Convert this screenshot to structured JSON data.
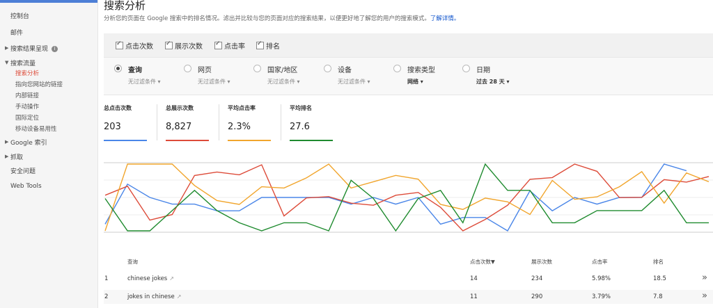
{
  "sidebar": {
    "items": {
      "dashboard": "控制台",
      "mail": "邮件",
      "search_appearance": "搜索结果呈现",
      "search_traffic": "搜索流量",
      "search_analytics": "搜索分析",
      "links": "指向您网站的链接",
      "internal_links": "内部链接",
      "manual_actions": "手动操作",
      "intl_targeting": "国际定位",
      "mobile_usability": "移动设备易用性",
      "google_index": "Google 索引",
      "crawl": "抓取",
      "security": "安全问题",
      "web_tools": "Web Tools"
    }
  },
  "page": {
    "title": "搜索分析",
    "description": "分析您的页面在 Google 搜索中的排名情况。滤出并比较与您的页面对应的搜索结果，以便更好地了解您的用户的搜索模式。",
    "learn_more": "了解详情。"
  },
  "metrics": {
    "clicks": "点击次数",
    "impressions": "展示次数",
    "ctr": "点击率",
    "position": "排名"
  },
  "filters": {
    "query": {
      "label": "查询",
      "sub": "无过滤条件 ▾"
    },
    "page": {
      "label": "网页",
      "sub": "无过滤条件 ▾"
    },
    "country": {
      "label": "国家/地区",
      "sub": "无过滤条件 ▾"
    },
    "device": {
      "label": "设备",
      "sub": "无过滤条件 ▾"
    },
    "search_type": {
      "label": "搜索类型",
      "sub": "网络 ▾"
    },
    "date": {
      "label": "日期",
      "sub": "过去 28 天 ▾"
    }
  },
  "totals": {
    "clicks": {
      "label": "总点击次数",
      "value": "203",
      "color": "#4a86e8"
    },
    "impressions": {
      "label": "总展示次数",
      "value": "8,827",
      "color": "#dd4b39"
    },
    "ctr": {
      "label": "平均点击率",
      "value": "2.3%",
      "color": "#f1a52c"
    },
    "position": {
      "label": "平均排名",
      "value": "27.6",
      "color": "#1f8b2f"
    }
  },
  "chart_data": {
    "type": "line",
    "x": [
      1,
      2,
      3,
      4,
      5,
      6,
      7,
      8,
      9,
      10,
      11,
      12,
      13,
      14,
      15,
      16,
      17,
      18,
      19,
      20,
      21,
      22,
      23,
      24,
      25,
      26,
      27,
      28
    ],
    "series": [
      {
        "color": "#4a86e8",
        "values": [
          2,
          8,
          6,
          5,
          5,
          4,
          4,
          6,
          6,
          6,
          6,
          5,
          6,
          5,
          6,
          2,
          3,
          3,
          1,
          7,
          4,
          6,
          5,
          6,
          6,
          11,
          10,
          null
        ]
      },
      {
        "color": "#dd4b39",
        "values": [
          276,
          302,
          204,
          220,
          333,
          343,
          335,
          364,
          216,
          268,
          272,
          253,
          247,
          276,
          284,
          241,
          173,
          206,
          247,
          322,
          327,
          366,
          345,
          269,
          270,
          321,
          314,
          330
        ]
      },
      {
        "color": "#f1a52c",
        "values": [
          0.5,
          5.8,
          5.8,
          5.8,
          4.1,
          2.9,
          2.6,
          4.0,
          3.9,
          4.7,
          5.8,
          3.9,
          4.4,
          4.9,
          4.6,
          2.6,
          2.2,
          3.1,
          2.8,
          1.8,
          4.5,
          3.0,
          3.2,
          4.0,
          5.2,
          2.7,
          5.1,
          4.4
        ]
      },
      {
        "color": "#1f8b2f",
        "values": [
          3.2,
          1.6,
          1.6,
          2.6,
          3.6,
          2.6,
          2.0,
          1.6,
          2.0,
          2.0,
          1.6,
          4.1,
          3.2,
          1.6,
          3.2,
          3.6,
          2.0,
          4.9,
          3.6,
          3.6,
          2.0,
          2.0,
          2.6,
          2.6,
          2.6,
          3.6,
          2.0,
          2.0
        ]
      }
    ]
  },
  "table": {
    "headers": {
      "query": "查询",
      "clicks": "点击次数▼",
      "impressions": "展示次数",
      "ctr": "点击率",
      "position": "排名"
    },
    "rows": [
      {
        "index": "1",
        "query": "chinese jokes",
        "clicks": "14",
        "impressions": "234",
        "ctr": "5.98%",
        "position": "18.5"
      },
      {
        "index": "2",
        "query": "jokes in chinese",
        "clicks": "11",
        "impressions": "290",
        "ctr": "3.79%",
        "position": "7.8"
      }
    ]
  }
}
